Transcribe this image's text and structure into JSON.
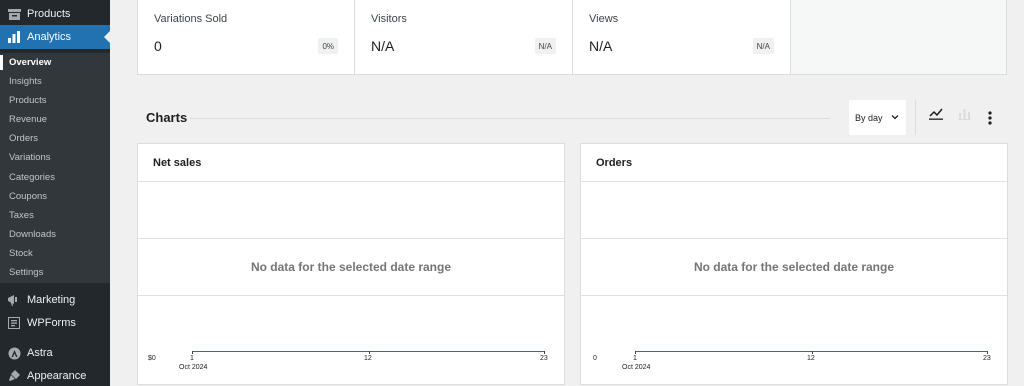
{
  "sidebar": {
    "products_label": "Products",
    "analytics_label": "Analytics",
    "submenu": [
      "Overview",
      "Insights",
      "Products",
      "Revenue",
      "Orders",
      "Variations",
      "Categories",
      "Coupons",
      "Taxes",
      "Downloads",
      "Stock",
      "Settings"
    ],
    "marketing_label": "Marketing",
    "wpforms_label": "WPForms",
    "astra_label": "Astra",
    "appearance_label": "Appearance"
  },
  "stats": [
    {
      "label": "Variations Sold",
      "value": "0",
      "delta": "0%"
    },
    {
      "label": "Visitors",
      "value": "N/A",
      "delta": "N/A"
    },
    {
      "label": "Views",
      "value": "N/A",
      "delta": "N/A"
    }
  ],
  "charts": {
    "section_title": "Charts",
    "interval": "By day",
    "panels": [
      {
        "title": "Net sales",
        "empty_message": "No data for the selected date range",
        "y_tick": "$0",
        "x_ticks": [
          "1",
          "12",
          "23"
        ],
        "x_sub": "Oct 2024"
      },
      {
        "title": "Orders",
        "empty_message": "No data for the selected date range",
        "y_tick": "0",
        "x_ticks": [
          "1",
          "12",
          "23"
        ],
        "x_sub": "Oct 2024"
      }
    ]
  },
  "colors": {
    "sidebar_bg": "#23282d",
    "submenu_bg": "#32373c",
    "active_bg": "#2271b1",
    "axis_line": "#3858e9"
  },
  "icons": [
    "products-icon",
    "analytics-icon",
    "marketing-icon",
    "wpforms-icon",
    "astra-icon",
    "appearance-icon",
    "line-chart-icon",
    "bar-chart-icon",
    "more-vertical-icon",
    "chevron-down-icon"
  ]
}
